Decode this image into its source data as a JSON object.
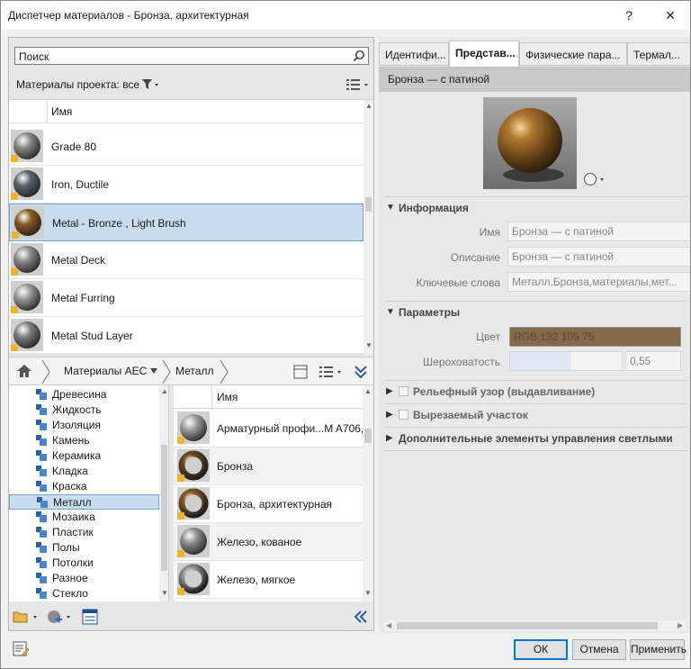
{
  "window": {
    "title": "Диспетчер материалов - Бронза, архитектурная",
    "help": "?",
    "close": "✕"
  },
  "search": {
    "placeholder": "Поиск"
  },
  "project": {
    "label": "Материалы проекта: все",
    "column_header": "Имя",
    "materials": [
      {
        "name": "Grade 80",
        "color": "#8a8a8a"
      },
      {
        "name": "Iron, Ductile",
        "color": "#5b636b"
      },
      {
        "name": "Metal - Bronze , Light Brush",
        "color": "#8a5a25",
        "selected": true
      },
      {
        "name": "Metal Deck",
        "color": "#8c8c8c"
      },
      {
        "name": "Metal Furring",
        "color": "#9a9a9a"
      },
      {
        "name": "Metal Stud Layer",
        "color": "#7f7f7f"
      }
    ]
  },
  "library": {
    "breadcrumb": [
      "Материалы AEC",
      "Металл"
    ],
    "tree": [
      "Древесина",
      "Жидкость",
      "Изоляция",
      "Камень",
      "Керамика",
      "Кладка",
      "Краска",
      "Металл",
      "Мозаика",
      "Пластик",
      "Полы",
      "Потолки",
      "Разное",
      "Стекло"
    ],
    "tree_selected": "Металл",
    "column_header": "Имя",
    "items": [
      {
        "name": "Арматурный профи...M A706,",
        "color": "#a0a0a0",
        "ring": false
      },
      {
        "name": "Бронза",
        "color": "#6b4a20",
        "ring": true
      },
      {
        "name": "Бронза, архитектурная",
        "color": "#8a5a25",
        "ring": true
      },
      {
        "name": "Железо, кованое",
        "color": "#8f8f8f",
        "ring": false
      },
      {
        "name": "Железо, мягкое",
        "color": "#9a9a9a",
        "ring": true
      }
    ]
  },
  "editor": {
    "tabs": [
      "Идентифи...",
      "Представ...",
      "Физические пара...",
      "Термал..."
    ],
    "active_tab": "Представ...",
    "asset_name": "Бронза — с патиной",
    "sections": {
      "info": "Информация",
      "params": "Параметры",
      "relief": "Рельефный узор (выдавливание)",
      "cutout": "Вырезаемый участок",
      "advanced": "Дополнительные элементы управления светлыми уча"
    },
    "info": {
      "name_label": "Имя",
      "name_value": "Бронза — с патиной",
      "desc_label": "Описание",
      "desc_value": "Бронза — с патиной",
      "keywords_label": "Ключевые слова",
      "keywords_value": "Металл,Бронза,материалы,мет..."
    },
    "params": {
      "color_label": "Цвет",
      "color_value": "RGB 132 105 75",
      "color_hex": "#84694b",
      "roughness_label": "Шероховатость",
      "roughness_value": "0,55"
    }
  },
  "buttons": {
    "ok": "ОК",
    "cancel": "Отмена",
    "apply": "Применить"
  }
}
